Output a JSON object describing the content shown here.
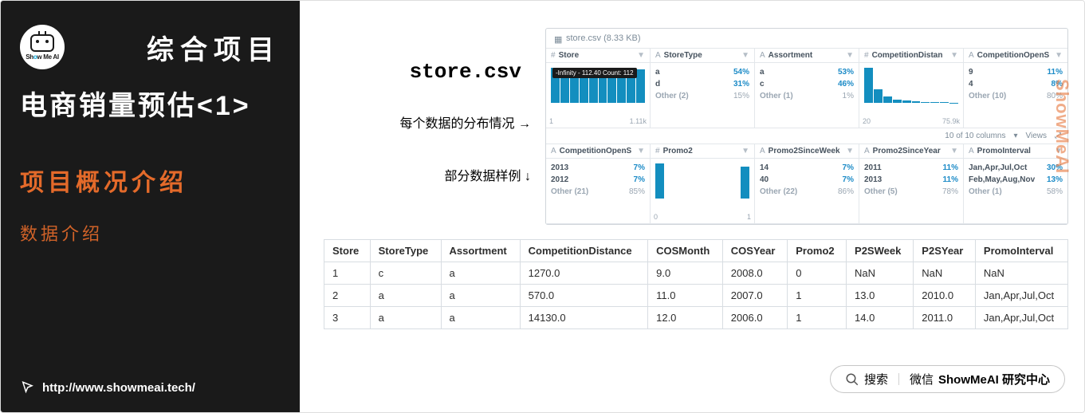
{
  "sidebar": {
    "logo_text_1": "Sh",
    "logo_text_o": "o",
    "logo_text_2": "w Me AI",
    "heading_a": "综合项目",
    "heading_b": "电商销量预估<1>",
    "section_active": "项目概况介绍",
    "section_sub": "数据介绍",
    "footer_url": "http://www.showmeai.tech/"
  },
  "csv": {
    "filename": "store.csv",
    "note_dist": "每个数据的分布情况  →",
    "note_sample": "部分数据样例  ↓"
  },
  "profile": {
    "file_label": "store.csv (8.33 KB)",
    "toolbar_cols": "10 of 10 columns",
    "toolbar_views": "Views",
    "row1": [
      {
        "type": "#",
        "name": "Store",
        "hist_tip": "-Infinity - 112.40\nCount: 112",
        "hist": [
          100,
          100,
          100,
          100,
          100,
          100,
          100,
          100,
          100,
          96
        ],
        "axis": [
          "1",
          "1.11k"
        ]
      },
      {
        "type": "A",
        "name": "StoreType",
        "items": [
          {
            "v": "a",
            "pct": "54%"
          },
          {
            "v": "d",
            "pct": "31%"
          },
          {
            "v": "Other (2)",
            "pct": "15%",
            "muted": true
          }
        ]
      },
      {
        "type": "A",
        "name": "Assortment",
        "items": [
          {
            "v": "a",
            "pct": "53%"
          },
          {
            "v": "c",
            "pct": "46%"
          },
          {
            "v": "Other (1)",
            "pct": "1%",
            "muted": true
          }
        ]
      },
      {
        "type": "#",
        "name": "CompetitionDistan",
        "hist": [
          100,
          38,
          18,
          10,
          6,
          4,
          3,
          2,
          2,
          1
        ],
        "axis": [
          "20",
          "75.9k"
        ]
      },
      {
        "type": "A",
        "name": "CompetitionOpenS",
        "items": [
          {
            "v": "9",
            "pct": "11%"
          },
          {
            "v": "4",
            "pct": "8%"
          },
          {
            "v": "Other (10)",
            "pct": "80%",
            "muted": true
          }
        ]
      }
    ],
    "row2": [
      {
        "type": "A",
        "name": "CompetitionOpenS",
        "items": [
          {
            "v": "2013",
            "pct": "7%"
          },
          {
            "v": "2012",
            "pct": "7%"
          },
          {
            "v": "Other (21)",
            "pct": "85%",
            "muted": true
          }
        ]
      },
      {
        "type": "#",
        "name": "Promo2",
        "hist": [
          100,
          0,
          0,
          0,
          0,
          0,
          0,
          0,
          0,
          92
        ],
        "axis": [
          "0",
          "1"
        ]
      },
      {
        "type": "A",
        "name": "Promo2SinceWeek",
        "items": [
          {
            "v": "14",
            "pct": "7%"
          },
          {
            "v": "40",
            "pct": "7%"
          },
          {
            "v": "Other (22)",
            "pct": "86%",
            "muted": true
          }
        ]
      },
      {
        "type": "A",
        "name": "Promo2SinceYear",
        "items": [
          {
            "v": "2011",
            "pct": "11%"
          },
          {
            "v": "2013",
            "pct": "11%"
          },
          {
            "v": "Other (5)",
            "pct": "78%",
            "muted": true
          }
        ]
      },
      {
        "type": "A",
        "name": "PromoInterval",
        "items": [
          {
            "v": "Jan,Apr,Jul,Oct",
            "pct": "30%"
          },
          {
            "v": "Feb,May,Aug,Nov",
            "pct": "13%"
          },
          {
            "v": "Other (1)",
            "pct": "58%",
            "muted": true
          }
        ]
      }
    ]
  },
  "table": {
    "headers": [
      "Store",
      "StoreType",
      "Assortment",
      "CompetitionDistance",
      "COSMonth",
      "COSYear",
      "Promo2",
      "P2SWeek",
      "P2SYear",
      "PromoInterval"
    ],
    "rows": [
      [
        "1",
        "c",
        "a",
        "1270.0",
        "9.0",
        "2008.0",
        "0",
        "NaN",
        "NaN",
        "NaN"
      ],
      [
        "2",
        "a",
        "a",
        "570.0",
        "11.0",
        "2007.0",
        "1",
        "13.0",
        "2010.0",
        "Jan,Apr,Jul,Oct"
      ],
      [
        "3",
        "a",
        "a",
        "14130.0",
        "12.0",
        "2006.0",
        "1",
        "14.0",
        "2011.0",
        "Jan,Apr,Jul,Oct"
      ]
    ]
  },
  "wx": {
    "search": "搜索",
    "sep": "｜",
    "wx": "微信",
    "brand": "ShowMeAI 研究中心"
  },
  "watermark": "ShowMeAI"
}
